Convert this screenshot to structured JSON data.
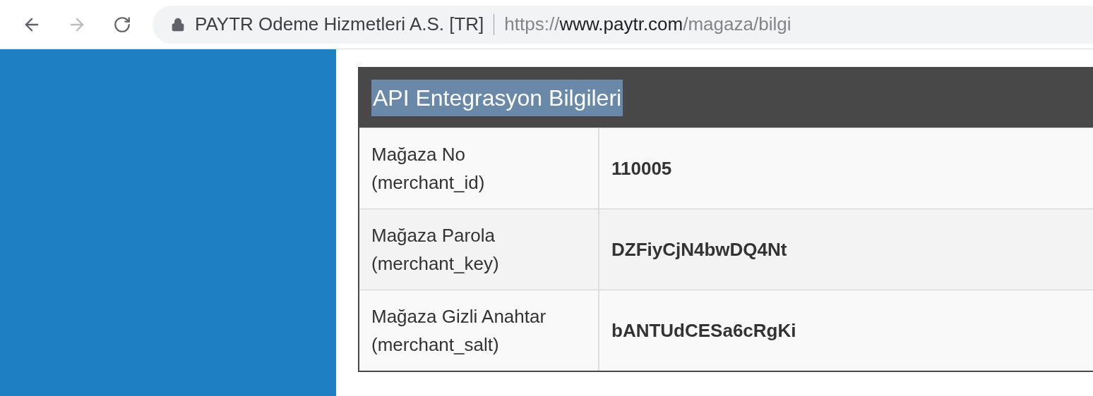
{
  "browser": {
    "back": {
      "disabled": false
    },
    "forward": {
      "disabled": true
    },
    "site_name": "PAYTR Odeme Hizmetleri A.S. [TR]",
    "url": {
      "scheme": "https://",
      "host": "www.paytr.com",
      "path": "/magaza/bilgi"
    }
  },
  "panel": {
    "title": "API Entegrasyon Bilgileri",
    "title_highlighted": true,
    "rows": [
      {
        "label": "Mağaza No",
        "sublabel": "(merchant_id)",
        "value": "110005"
      },
      {
        "label": "Mağaza Parola",
        "sublabel": "(merchant_key)",
        "value": "DZFiyCjN4bwDQ4Nt"
      },
      {
        "label": "Mağaza Gizli Anahtar",
        "sublabel": "(merchant_salt)",
        "value": "bANTUdCESa6cRgKi"
      }
    ]
  }
}
